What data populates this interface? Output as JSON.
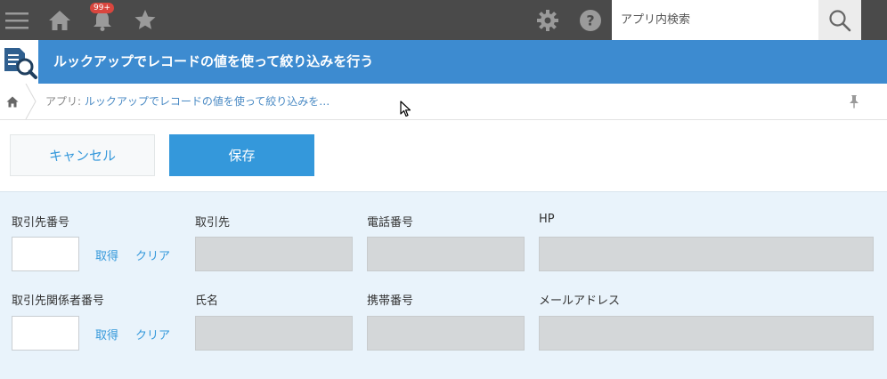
{
  "topbar": {
    "notification_badge": "99+",
    "search_placeholder": "アプリ内検索"
  },
  "app": {
    "title": "ルックアップでレコードの値を使って絞り込みを行う"
  },
  "breadcrumb": {
    "label": "アプリ: ",
    "app_name": "ルックアップでレコードの値を使って絞り込みを…"
  },
  "actions": {
    "cancel_label": "キャンセル",
    "save_label": "保存"
  },
  "form": {
    "row1": {
      "lookup_label": "取引先番号",
      "lookup_value": "",
      "fetch_label": "取得",
      "clear_label": "クリア",
      "field2_label": "取引先",
      "field3_label": "電話番号",
      "field4_label": "HP"
    },
    "row2": {
      "lookup_label": "取引先関係者番号",
      "lookup_value": "",
      "fetch_label": "取得",
      "clear_label": "クリア",
      "field2_label": "氏名",
      "field3_label": "携帯番号",
      "field4_label": "メールアドレス"
    }
  },
  "colors": {
    "topbar": "#4a4a4a",
    "appbar": "#3d8bd0",
    "accent": "#3498db",
    "form_bg": "#e9f3fb",
    "disabled_field": "#d4d7d9"
  }
}
